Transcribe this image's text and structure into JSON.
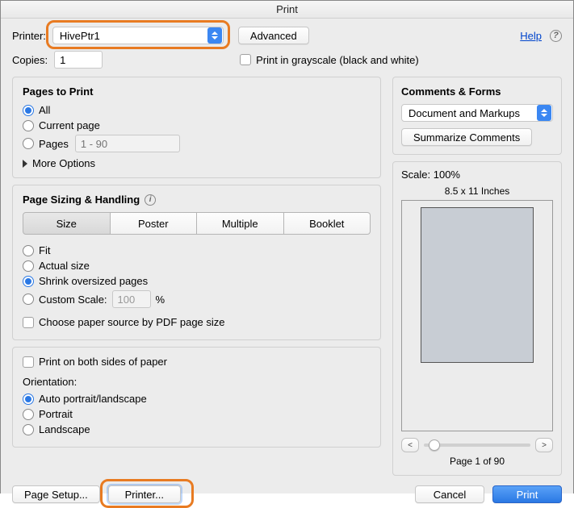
{
  "window": {
    "title": "Print"
  },
  "header": {
    "printer_label": "Printer:",
    "printer_value": "HivePtr1",
    "advanced": "Advanced",
    "help": "Help",
    "copies_label": "Copies:",
    "copies_value": "1",
    "grayscale": "Print in grayscale (black and white)"
  },
  "pages": {
    "title": "Pages to Print",
    "all": "All",
    "current": "Current page",
    "pages": "Pages",
    "pages_placeholder": "1 - 90",
    "more": "More Options"
  },
  "sizing": {
    "title": "Page Sizing & Handling",
    "tabs": {
      "size": "Size",
      "poster": "Poster",
      "multiple": "Multiple",
      "booklet": "Booklet"
    },
    "fit": "Fit",
    "actual": "Actual size",
    "shrink": "Shrink oversized pages",
    "custom_label": "Custom Scale:",
    "custom_value": "100",
    "percent": "%",
    "choose_paper": "Choose paper source by PDF page size"
  },
  "both_sides": "Print on both sides of paper",
  "orientation": {
    "title": "Orientation:",
    "auto": "Auto portrait/landscape",
    "portrait": "Portrait",
    "landscape": "Landscape"
  },
  "comments": {
    "title": "Comments & Forms",
    "value": "Document and Markups",
    "summarize": "Summarize Comments"
  },
  "preview": {
    "scale": "Scale: 100%",
    "paper": "8.5 x 11 Inches",
    "page_info": "Page 1 of 90"
  },
  "footer": {
    "page_setup": "Page Setup...",
    "printer": "Printer...",
    "cancel": "Cancel",
    "print": "Print"
  }
}
